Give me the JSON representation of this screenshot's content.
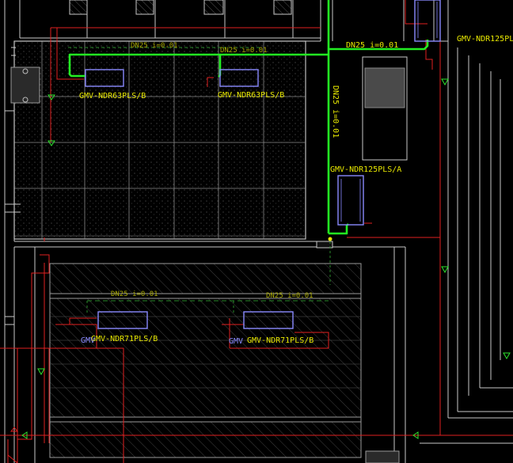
{
  "colors": {
    "background": "#000000",
    "wall": "#c8c8c8",
    "pipe_green": "#22ee22",
    "pipe_red": "#e02020",
    "unit_blue": "#8a8aff",
    "label_yellow": "#e8e800",
    "dim_green": "#2a8a2a",
    "hatch": "#606060"
  },
  "labels": {
    "unit_top_left": "GMV-NDR63PLS/B",
    "unit_top_mid": "GMV-NDR63PLS/B",
    "unit_right_mid": "GMV-NDR125PLS/A",
    "unit_right_top": "GMV-NDR125PL",
    "unit_bot_left": "GMV-NDR71PLS/B",
    "unit_bot_left_overlap": "GMV",
    "unit_bot_right": "GMV-NDR71PLS/B",
    "unit_bot_right_overlap": "GMV",
    "pipe_h": "DN25 i=0.01",
    "pipe_v": "DN25 i=0.01",
    "pipe_top_faint": "DN25 i=0.01",
    "pipe_top_faint2": "DN25 i=0.01",
    "pipe_bot_faint": "DN25 i=0.01",
    "pipe_bot_faint2": "DN25 i=0.01"
  }
}
